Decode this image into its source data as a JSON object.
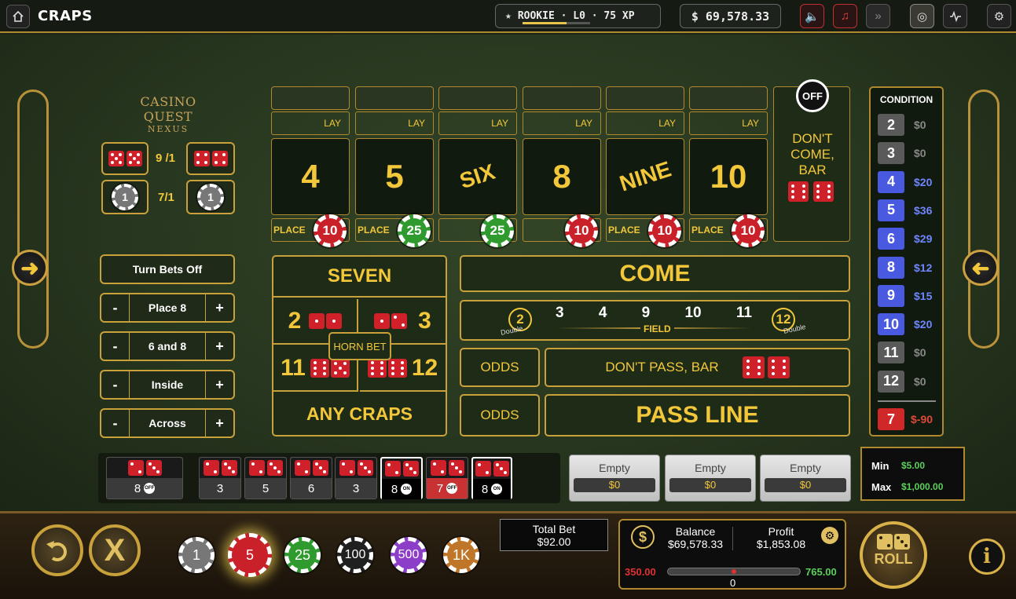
{
  "topbar": {
    "title": "CRAPS",
    "rank_text": "ROOKIE · L0 · 75 XP",
    "xp_progress": 0.65,
    "balance": "$ 69,578.33",
    "icons": [
      "home-icon",
      "volume-icon",
      "music-icon",
      "fast-forward-icon",
      "target-icon",
      "activity-icon",
      "gear-icon"
    ]
  },
  "logo": {
    "line1": "CASINO QUEST",
    "line2": "NEXUS"
  },
  "props": {
    "odds_top": "9 /1",
    "odds_bottom": "7/1",
    "chip_left": "1",
    "chip_right": "1"
  },
  "controls": {
    "turn_off": "Turn Bets Off",
    "rows": [
      {
        "minus": "-",
        "label": "Place 8",
        "plus": "+"
      },
      {
        "minus": "-",
        "label": "6 and 8",
        "plus": "+"
      },
      {
        "minus": "-",
        "label": "Inside",
        "plus": "+"
      },
      {
        "minus": "-",
        "label": "Across",
        "plus": "+"
      }
    ]
  },
  "points": [
    {
      "label": "4",
      "lay": "LAY",
      "place": "PLACE",
      "chip": "10",
      "chip_color": "#c9202a"
    },
    {
      "label": "5",
      "lay": "LAY",
      "place": "PLACE",
      "chip": "25",
      "chip_color": "#2f9b2f"
    },
    {
      "label": "SIX",
      "lay": "LAY",
      "place": "",
      "chip": "25",
      "chip_color": "#2f9b2f"
    },
    {
      "label": "8",
      "lay": "LAY",
      "place": "",
      "chip": "10",
      "chip_color": "#c9202a"
    },
    {
      "label": "NINE",
      "lay": "LAY",
      "place": "PLACE",
      "chip": "10",
      "chip_color": "#c9202a"
    },
    {
      "label": "10",
      "lay": "LAY",
      "place": "PLACE",
      "chip": "10",
      "chip_color": "#c9202a"
    }
  ],
  "dont_come": {
    "off": "OFF",
    "label": "DON'T COME, BAR"
  },
  "center": {
    "seven": "SEVEN",
    "two": "2",
    "three": "3",
    "horn": "HORN BET",
    "eleven": "11",
    "twelve": "12",
    "any_craps": "ANY CRAPS",
    "come": "COME",
    "field_nums": [
      "3",
      "4",
      "9",
      "10",
      "11"
    ],
    "field_left": "2",
    "field_right": "12",
    "field_label": "FIELD",
    "double": "Double",
    "odds": "ODDS",
    "dont_pass": "DON'T PASS, BAR",
    "pass_line": "PASS LINE"
  },
  "condition": {
    "title": "CONDITION",
    "rows": [
      {
        "n": "2",
        "v": "$0",
        "color": "#5a5a5a",
        "vcolor": "#888"
      },
      {
        "n": "3",
        "v": "$0",
        "color": "#5a5a5a",
        "vcolor": "#888"
      },
      {
        "n": "4",
        "v": "$20",
        "color": "#4a5ae0",
        "vcolor": "#6f86ff"
      },
      {
        "n": "5",
        "v": "$36",
        "color": "#4a5ae0",
        "vcolor": "#6f86ff"
      },
      {
        "n": "6",
        "v": "$29",
        "color": "#4a5ae0",
        "vcolor": "#6f86ff"
      },
      {
        "n": "8",
        "v": "$12",
        "color": "#4a5ae0",
        "vcolor": "#6f86ff"
      },
      {
        "n": "9",
        "v": "$15",
        "color": "#4a5ae0",
        "vcolor": "#6f86ff"
      },
      {
        "n": "10",
        "v": "$20",
        "color": "#4a5ae0",
        "vcolor": "#6f86ff"
      },
      {
        "n": "11",
        "v": "$0",
        "color": "#5a5a5a",
        "vcolor": "#888"
      },
      {
        "n": "12",
        "v": "$0",
        "color": "#5a5a5a",
        "vcolor": "#888"
      }
    ],
    "seven": {
      "n": "7",
      "v": "$-90",
      "color": "#d02828",
      "vcolor": "#e04a3a"
    }
  },
  "history": [
    {
      "sum": "8",
      "tag": "OFF"
    },
    {
      "sum": "3",
      "tag": ""
    },
    {
      "sum": "5",
      "tag": ""
    },
    {
      "sum": "6",
      "tag": ""
    },
    {
      "sum": "3",
      "tag": ""
    },
    {
      "sum": "8",
      "tag": "ON"
    },
    {
      "sum": "7",
      "tag": "OFF"
    },
    {
      "sum": "8",
      "tag": "ON"
    }
  ],
  "slots": [
    {
      "label": "Empty",
      "value": "$0"
    },
    {
      "label": "Empty",
      "value": "$0"
    },
    {
      "label": "Empty",
      "value": "$0"
    }
  ],
  "limits": {
    "min_label": "Min",
    "min": "$5.00",
    "max_label": "Max",
    "max": "$1,000.00"
  },
  "chips": [
    "1",
    "5",
    "25",
    "100",
    "500",
    "1K"
  ],
  "total_bet": {
    "label": "Total Bet",
    "value": "$92.00"
  },
  "summary": {
    "balance_label": "Balance",
    "balance": "$69,578.33",
    "profit_label": "Profit",
    "profit": "$1,853.08",
    "low": "350.00",
    "high": "765.00",
    "zero": "0",
    "marker": 0.48
  },
  "roll": "ROLL",
  "info": "i"
}
